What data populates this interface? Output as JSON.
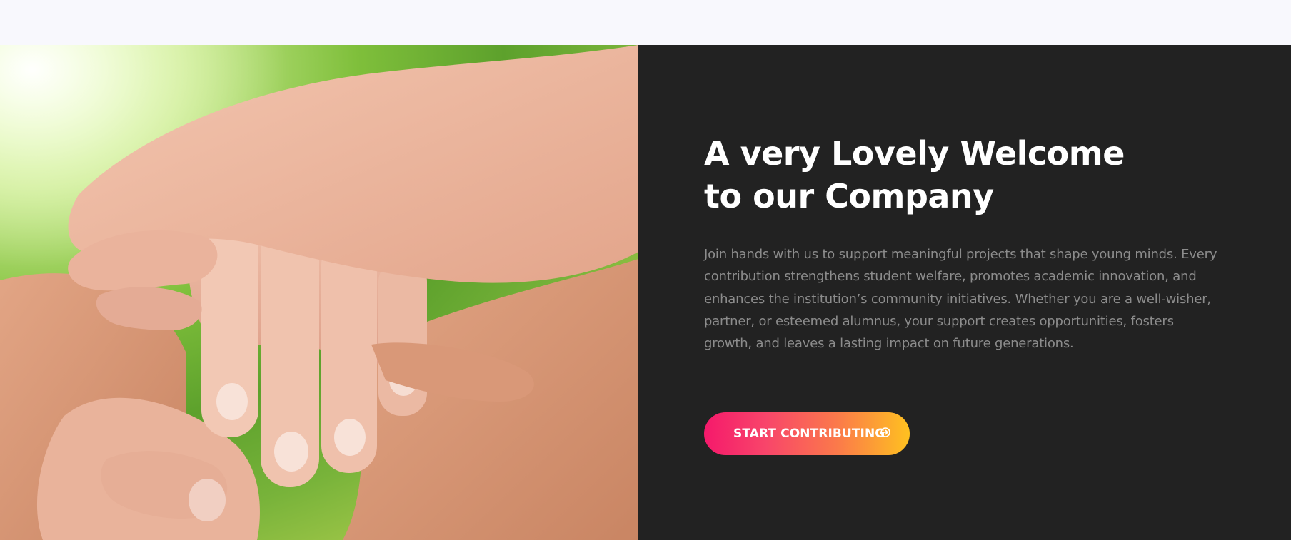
{
  "hero": {
    "heading_line1": "A very Lovely Welcome",
    "heading_line2": "to our Company",
    "description": "Join hands with us to support meaningful projects that shape young minds. Every contribution strengthens student welfare, promotes academic innovation, and enhances the institution’s community initiatives. Whether you are a well-wisher, partner, or esteemed alumnus, your support creates opportunities, fosters growth, and leaves a lasting impact on future generations.",
    "cta_label": "START CONTRIBUTING",
    "cta_icon": "arrow-circle-icon",
    "image_subject": "stacked-hands-photo"
  },
  "colors": {
    "page_background": "#f8f8fd",
    "panel_background": "#222222",
    "heading": "#ffffff",
    "body_text": "#8c8c8c",
    "cta_gradient_start": "#f5196b",
    "cta_gradient_end": "#fec120"
  }
}
